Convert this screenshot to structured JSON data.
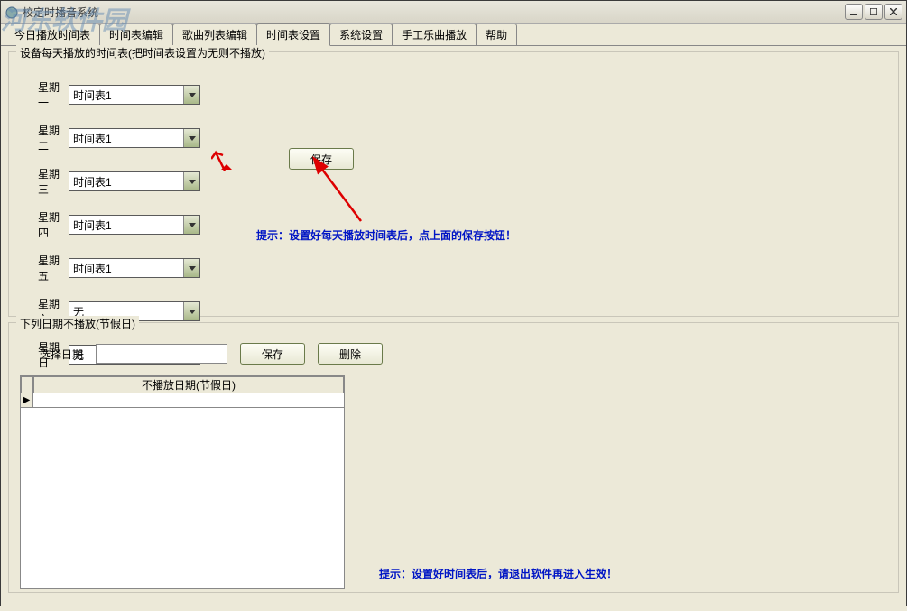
{
  "window": {
    "title": "校定时播音系统"
  },
  "watermark": "河东软件园",
  "tabs": [
    "今日播放时间表",
    "时间表编辑",
    "歌曲列表编辑",
    "时间表设置",
    "系统设置",
    "手工乐曲播放",
    "帮助"
  ],
  "active_tab_index": 3,
  "group1": {
    "title": "设备每天播放的时间表(把时间表设置为无则不播放)",
    "days": [
      {
        "label": "星期一",
        "value": "时间表1"
      },
      {
        "label": "星期二",
        "value": "时间表1"
      },
      {
        "label": "星期三",
        "value": "时间表1"
      },
      {
        "label": "星期四",
        "value": "时间表1"
      },
      {
        "label": "星期五",
        "value": "时间表1"
      },
      {
        "label": "星期六",
        "value": "无"
      },
      {
        "label": "星期日",
        "value": "无"
      }
    ],
    "save_btn": "保存",
    "hint": "提示：设置好每天播放时间表后，点上面的保存按钮！"
  },
  "group2": {
    "title": "下列日期不播放(节假日)",
    "select_date_label": "选择日期",
    "save_btn": "保存",
    "delete_btn": "删除",
    "table_header": "不播放日期(节假日)",
    "hint": "提示：设置好时间表后，请退出软件再进入生效！"
  }
}
